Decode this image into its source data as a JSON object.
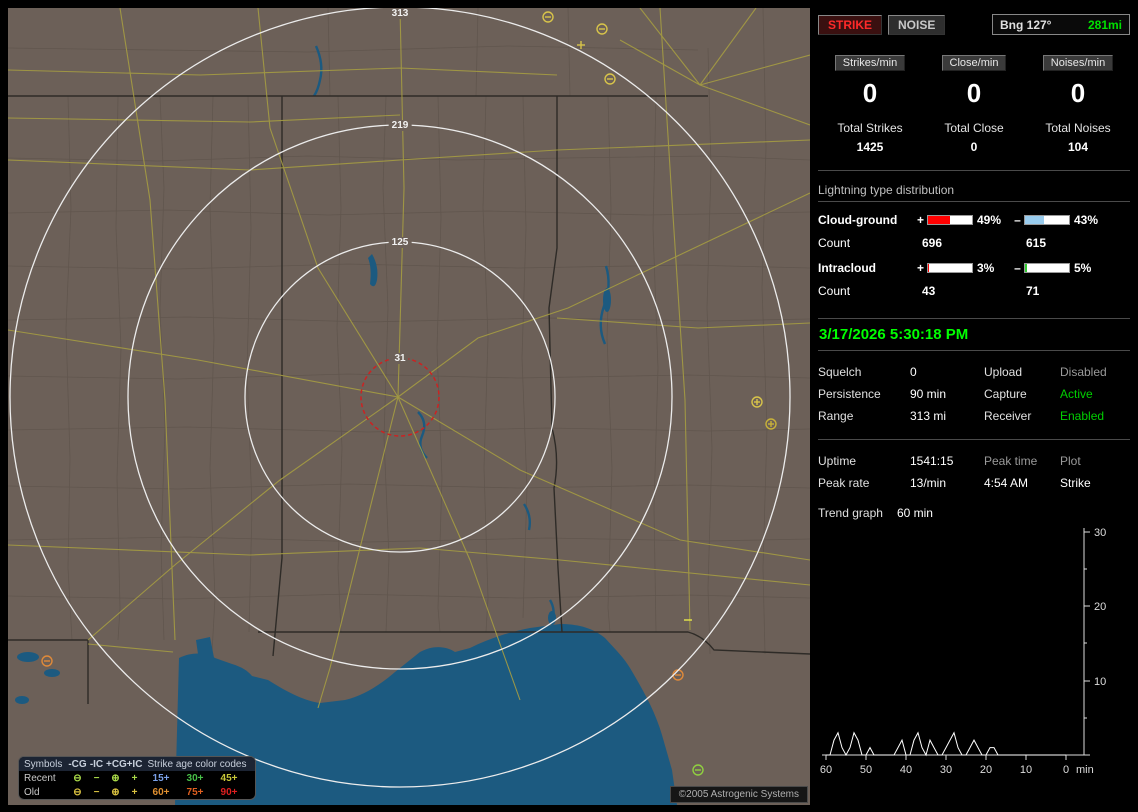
{
  "map": {
    "ring_labels": [
      "313",
      "219",
      "125",
      "31"
    ],
    "copyright": "©2005 Astrogenic Systems",
    "legend": {
      "symbols_header": "Symbols",
      "age_header": "Strike age color codes",
      "columns": [
        "-CG",
        "-IC",
        "+CG",
        "+IC"
      ],
      "rows": [
        {
          "label": "Recent",
          "symbols": [
            "⊖",
            "−",
            "⊕",
            "+"
          ],
          "color": "#a8d848",
          "ages": [
            {
              "text": "15+",
              "color": "#7aa0e8"
            },
            {
              "text": "30+",
              "color": "#48c048"
            },
            {
              "text": "45+",
              "color": "#c8c838"
            }
          ]
        },
        {
          "label": "Old",
          "symbols": [
            "⊖",
            "−",
            "⊕",
            "+"
          ],
          "color": "#d8c040",
          "ages": [
            {
              "text": "60+",
              "color": "#e09030"
            },
            {
              "text": "75+",
              "color": "#e06020"
            },
            {
              "text": "90+",
              "color": "#e02020"
            }
          ]
        }
      ]
    }
  },
  "panel": {
    "strike_btn": "STRIKE",
    "noise_btn": "NOISE",
    "bearing_label": "Bng 127°",
    "bearing_range": "281mi",
    "rate_cols": [
      {
        "label": "Strikes/min",
        "value": "0",
        "total_label": "Total Strikes",
        "total": "1425"
      },
      {
        "label": "Close/min",
        "value": "0",
        "total_label": "Total Close",
        "total": "0"
      },
      {
        "label": "Noises/min",
        "value": "0",
        "total_label": "Total Noises",
        "total": "104"
      }
    ],
    "distribution": {
      "title": "Lightning type distribution",
      "plus_symbol": "+",
      "minus_symbol": "–",
      "rows": [
        {
          "name": "Cloud-ground",
          "plus_pct": "49%",
          "minus_pct": "43%",
          "plus_fill": 49,
          "minus_fill": 43,
          "plus_color": "#ff0000",
          "minus_color": "#99ccee",
          "count_label": "Count",
          "plus_count": "696",
          "minus_count": "615"
        },
        {
          "name": "Intracloud",
          "plus_pct": "3%",
          "minus_pct": "5%",
          "plus_fill": 3,
          "minus_fill": 5,
          "plus_color": "#ff0000",
          "minus_color": "#33cc33",
          "count_label": "Count",
          "plus_count": "43",
          "minus_count": "71"
        }
      ]
    },
    "timestamp": "3/17/2026 5:30:18 PM",
    "status": [
      {
        "label": "Squelch",
        "value": "0",
        "label2": "Upload",
        "value2": "Disabled",
        "value2_color": "#9a9a9a"
      },
      {
        "label": "Persistence",
        "value": "90 min",
        "label2": "Capture",
        "value2": "Active",
        "value2_color": "#00d000"
      },
      {
        "label": "Range",
        "value": "313 mi",
        "label2": "Receiver",
        "value2": "Enabled",
        "value2_color": "#00d000"
      }
    ],
    "uptime": {
      "label": "Uptime",
      "value": "1541:15",
      "peak_time_label": "Peak time",
      "plot_label": "Plot",
      "rate_label": "Peak rate",
      "rate_value": "13/min",
      "peak_time": "4:54 AM",
      "plot_value": "Strike"
    },
    "trend": {
      "label": "Trend graph",
      "window": "60 min"
    },
    "chart": {
      "type": "line",
      "x_ticks": [
        "60",
        "50",
        "40",
        "30",
        "20",
        "10",
        "0"
      ],
      "x_unit": "min",
      "y_ticks": [
        "30",
        "20",
        "10"
      ],
      "y_max": 30,
      "values": [
        0,
        0,
        2,
        3,
        1,
        0,
        1,
        3,
        2,
        0,
        0,
        1,
        0,
        0,
        0,
        0,
        0,
        0,
        1,
        2,
        0,
        0,
        2,
        3,
        1,
        0,
        2,
        1,
        0,
        0,
        1,
        2,
        3,
        1,
        0,
        0,
        1,
        2,
        1,
        0,
        0,
        1,
        1,
        0,
        0,
        0,
        0,
        0,
        0,
        0,
        0,
        0,
        0,
        0,
        0,
        0,
        0,
        0,
        0,
        0,
        0
      ]
    }
  }
}
